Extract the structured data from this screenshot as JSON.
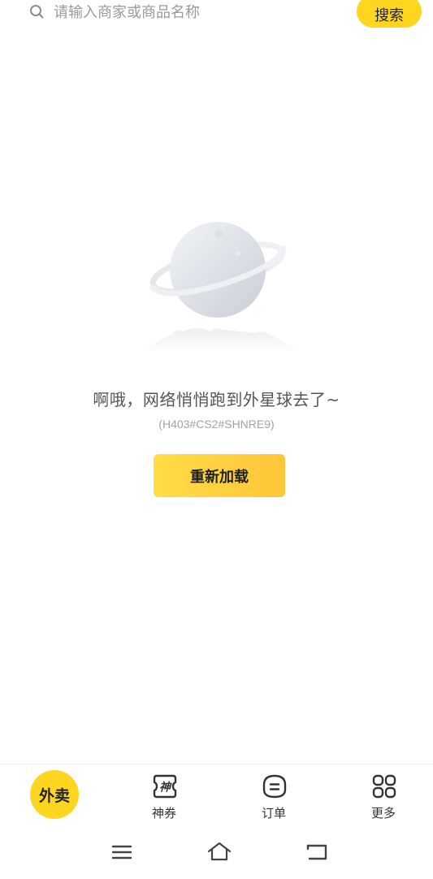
{
  "search": {
    "placeholder": "请输入商家或商品名称",
    "button_label": "搜索"
  },
  "error": {
    "message": "啊哦，网络悄悄跑到外星球去了~",
    "code": "(H403#CS2#SHNRE9)",
    "reload_label": "重新加载"
  },
  "bottom_nav": {
    "items": [
      {
        "label": "外卖",
        "icon": "waimai-icon",
        "active": true
      },
      {
        "label": "神券",
        "icon": "shen-coupon-icon"
      },
      {
        "label": "订单",
        "icon": "order-icon"
      },
      {
        "label": "更多",
        "icon": "grid-icon"
      }
    ]
  },
  "system_nav": {
    "items": [
      {
        "icon": "menu-icon"
      },
      {
        "icon": "home-icon"
      },
      {
        "icon": "back-icon"
      }
    ]
  },
  "colors": {
    "accent": "#ffd61f",
    "button_gradient_start": "#ffdd45",
    "button_gradient_end": "#ffc53a",
    "text_primary": "#333333",
    "text_secondary": "#a3a3a3"
  }
}
